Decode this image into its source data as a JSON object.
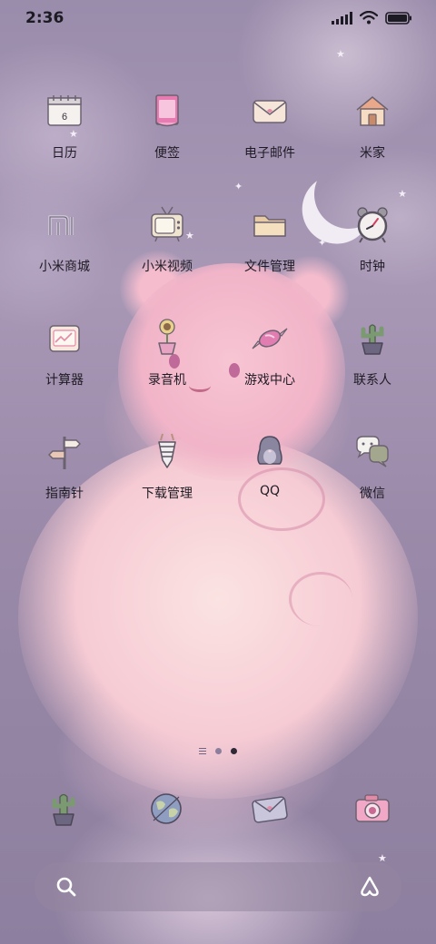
{
  "status_bar": {
    "time": "2:36",
    "icons": [
      "signal-icon",
      "wifi-icon",
      "battery-icon"
    ]
  },
  "apps": [
    {
      "label": "日历",
      "icon": "calendar-icon",
      "calendar_date": "6"
    },
    {
      "label": "便签",
      "icon": "notes-icon"
    },
    {
      "label": "电子邮件",
      "icon": "email-icon"
    },
    {
      "label": "米家",
      "icon": "home-icon"
    },
    {
      "label": "小米商城",
      "icon": "mi-store-icon"
    },
    {
      "label": "小米视频",
      "icon": "tv-icon"
    },
    {
      "label": "文件管理",
      "icon": "folder-icon"
    },
    {
      "label": "时钟",
      "icon": "alarm-clock-icon"
    },
    {
      "label": "计算器",
      "icon": "calculator-icon"
    },
    {
      "label": "录音机",
      "icon": "sunflower-recorder-icon"
    },
    {
      "label": "游戏中心",
      "icon": "candy-icon"
    },
    {
      "label": "联系人",
      "icon": "cactus-icon"
    },
    {
      "label": "指南针",
      "icon": "signpost-icon"
    },
    {
      "label": "下载管理",
      "icon": "rocket-icon"
    },
    {
      "label": "QQ",
      "icon": "penguin-icon"
    },
    {
      "label": "微信",
      "icon": "chat-bubbles-icon"
    }
  ],
  "page_indicator": {
    "pages": 2,
    "active_page": 2,
    "leading_icon": "list-icon"
  },
  "dock": [
    {
      "icon": "cactus-pot-icon"
    },
    {
      "icon": "globe-icon"
    },
    {
      "icon": "envelope-icon"
    },
    {
      "icon": "camera-icon"
    }
  ],
  "search_bar": {
    "left_icon": "search-icon",
    "right_icon": "assistant-icon"
  },
  "colors": {
    "label_text": "#1f1b24",
    "wallpaper_purple": "#9a8cab",
    "bear_pink": "#f1b4c8"
  }
}
